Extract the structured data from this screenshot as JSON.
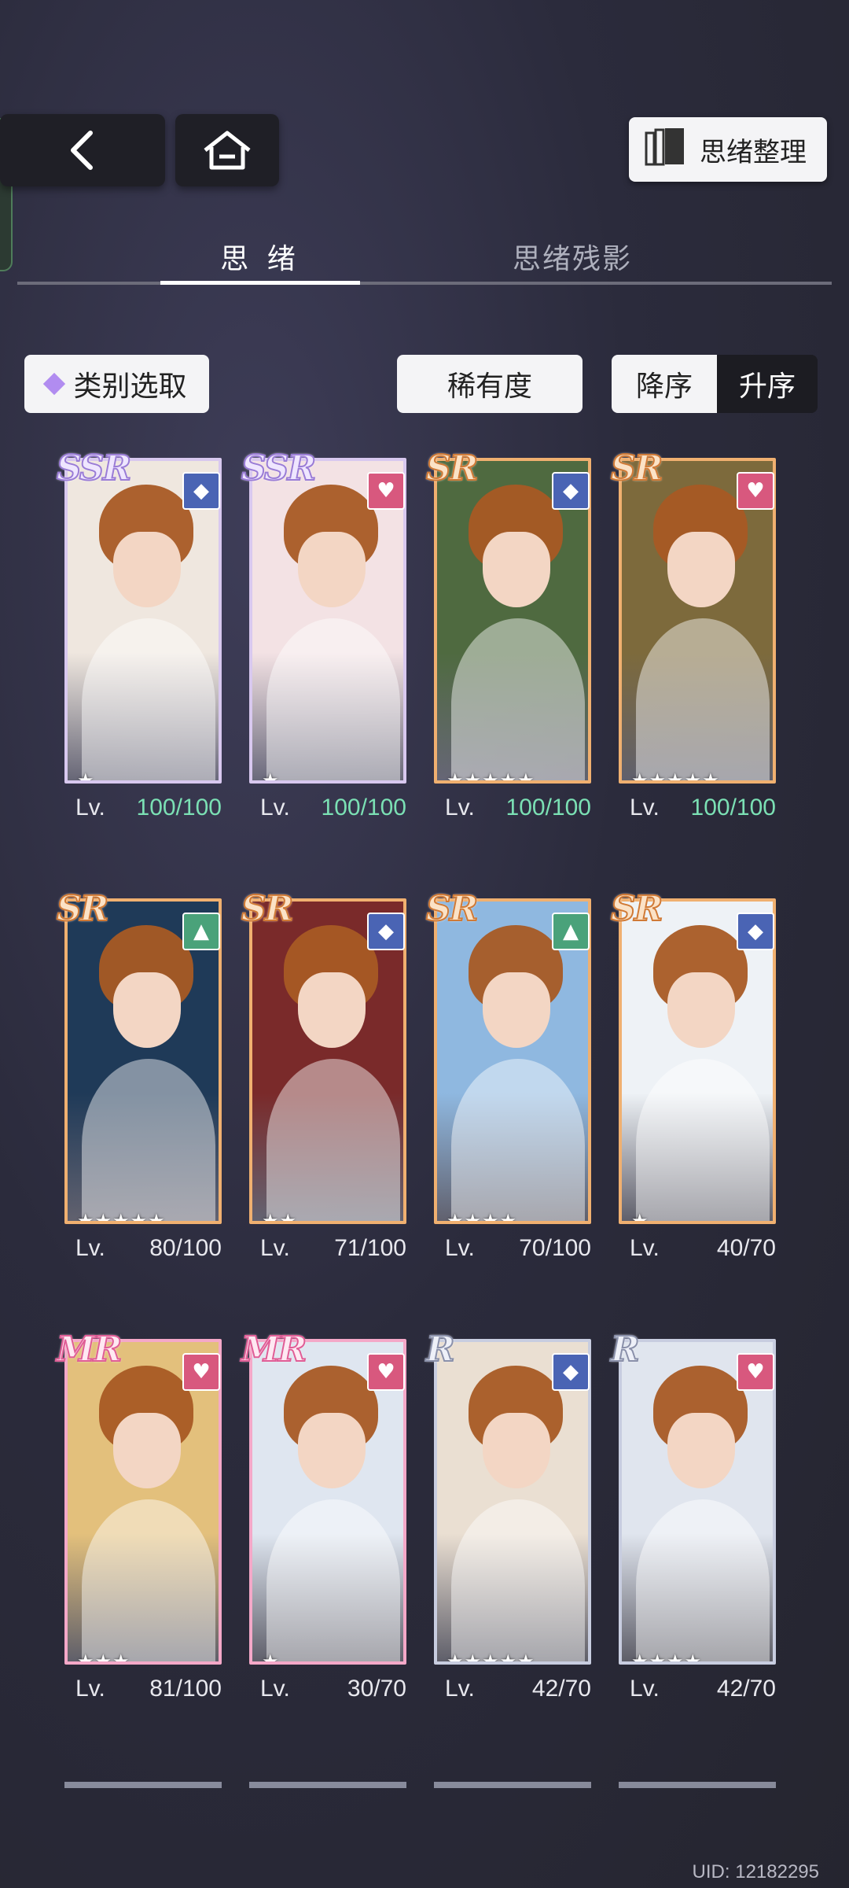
{
  "header": {
    "organize_label": "思绪整理"
  },
  "tabs": [
    {
      "label": "思 绪",
      "active": true
    },
    {
      "label": "思绪残影",
      "active": false
    }
  ],
  "filters": {
    "category_label": "类别选取",
    "rarity_label": "稀有度",
    "desc_label": "降序",
    "asc_label": "升序",
    "selected_order": "升序"
  },
  "cards": [
    {
      "rarity": "SSR",
      "type": "diamond",
      "stars": "★",
      "lv_label": "Lv.",
      "level": "100/100",
      "maxed": true
    },
    {
      "rarity": "SSR",
      "type": "heart",
      "stars": "★",
      "lv_label": "Lv.",
      "level": "100/100",
      "maxed": true
    },
    {
      "rarity": "SR",
      "type": "diamond",
      "stars": "★★★★★",
      "lv_label": "Lv.",
      "level": "100/100",
      "maxed": true
    },
    {
      "rarity": "SR",
      "type": "heart",
      "stars": "★★★★★",
      "lv_label": "Lv.",
      "level": "100/100",
      "maxed": true
    },
    {
      "rarity": "SR",
      "type": "triangle",
      "stars": "★★★★★",
      "lv_label": "Lv.",
      "level": "80/100",
      "maxed": false
    },
    {
      "rarity": "SR",
      "type": "diamond",
      "stars": "★★",
      "lv_label": "Lv.",
      "level": "71/100",
      "maxed": false
    },
    {
      "rarity": "SR",
      "type": "triangle",
      "stars": "★★★★",
      "lv_label": "Lv.",
      "level": "70/100",
      "maxed": false
    },
    {
      "rarity": "SR",
      "type": "diamond",
      "stars": "★",
      "lv_label": "Lv.",
      "level": "40/70",
      "maxed": false
    },
    {
      "rarity": "MR",
      "type": "heart",
      "stars": "★★★",
      "lv_label": "Lv.",
      "level": "81/100",
      "maxed": false
    },
    {
      "rarity": "MR",
      "type": "heart",
      "stars": "★",
      "lv_label": "Lv.",
      "level": "30/70",
      "maxed": false
    },
    {
      "rarity": "R",
      "type": "diamond",
      "stars": "★★★★★",
      "lv_label": "Lv.",
      "level": "42/70",
      "maxed": false
    },
    {
      "rarity": "R",
      "type": "heart",
      "stars": "★★★★",
      "lv_label": "Lv.",
      "level": "42/70",
      "maxed": false
    }
  ],
  "footer": {
    "uid": "UID: 12182295"
  },
  "colors": {
    "maxed_level": "#7be0b4",
    "badge_blue": "#4a64b4",
    "badge_pink": "#d8587e",
    "badge_green": "#4aa27a"
  }
}
